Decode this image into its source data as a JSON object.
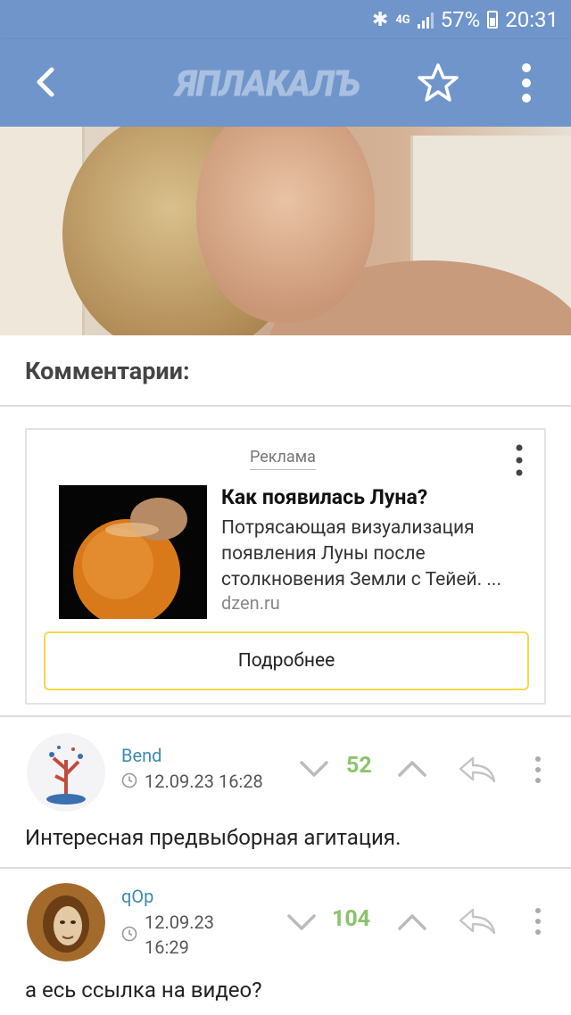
{
  "status_bar": {
    "signal_label": "4G",
    "battery": "57%",
    "time": "20:31"
  },
  "app_bar": {
    "logo": "ЯПЛАКАЛЪ",
    "icons": [
      "back-arrow-icon",
      "star-icon",
      "more-vertical-icon"
    ]
  },
  "comments_section": {
    "title": "Комментарии:"
  },
  "ad": {
    "label": "Реклама",
    "title": "Как появилась Луна?",
    "text": "Потрясающая визуализация появления Луны после столкновения Земли с Тейей. ...",
    "domain": "dzen.ru",
    "button": "Подробнее"
  },
  "comments": [
    {
      "author": "Bend",
      "date": "12.09.23 16:28",
      "score": "52",
      "text": "Интересная предвыборная агитация."
    },
    {
      "author": "qOp",
      "date_line1": "12.09.23",
      "date_line2": "16:29",
      "score": "104",
      "text": "а есь ссылка на видео?"
    }
  ],
  "colors": {
    "app_bar": "#6f95cb",
    "author": "#3d8ab0",
    "score": "#8bc36b",
    "ad_button_border": "#f5d84a"
  }
}
